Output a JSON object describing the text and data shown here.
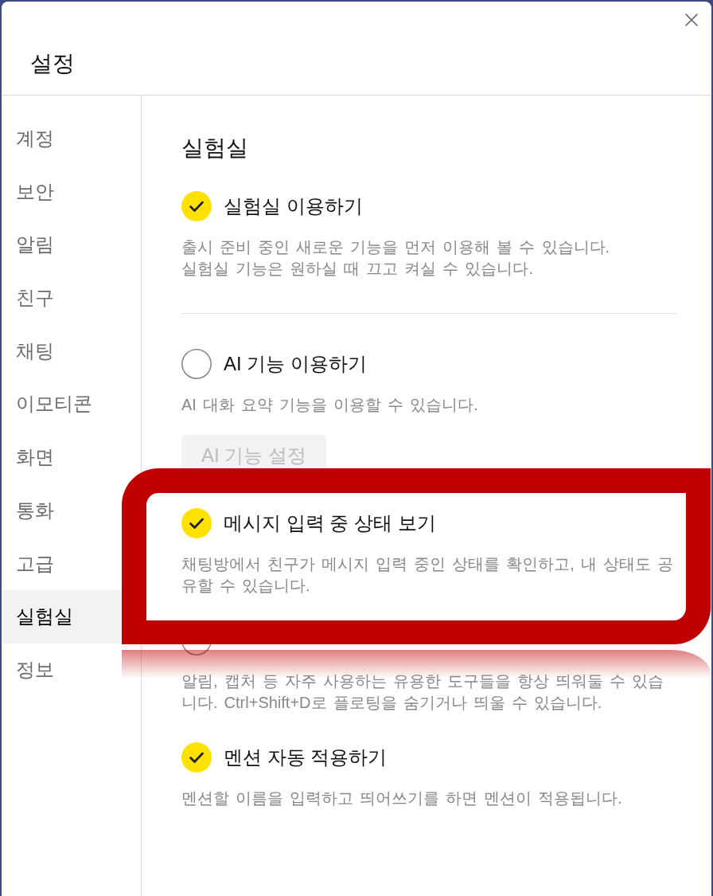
{
  "window": {
    "title": "설정"
  },
  "sidebar": {
    "items": [
      {
        "label": "계정",
        "selected": false
      },
      {
        "label": "보안",
        "selected": false
      },
      {
        "label": "알림",
        "selected": false
      },
      {
        "label": "친구",
        "selected": false
      },
      {
        "label": "채팅",
        "selected": false
      },
      {
        "label": "이모티콘",
        "selected": false
      },
      {
        "label": "화면",
        "selected": false
      },
      {
        "label": "통화",
        "selected": false
      },
      {
        "label": "고급",
        "selected": false
      },
      {
        "label": "실험실",
        "selected": true
      },
      {
        "label": "정보",
        "selected": false
      }
    ]
  },
  "section": {
    "heading": "실험실",
    "master": {
      "title": "실험실 이용하기",
      "checked": true,
      "description": "출시 준비 중인 새로운 기능을 먼저 이용해 볼 수 있습니다.\n실험실 기능은 원하실 때 끄고 켜실 수 있습니다."
    },
    "features": [
      {
        "title": "AI 기능 이용하기",
        "checked": false,
        "highlighted": false,
        "description": "AI 대화 요약 기능을 이용할 수 있습니다.",
        "button": {
          "label": "AI 기능 설정",
          "disabled": true
        }
      },
      {
        "title": "메시지 입력 중 상태 보기",
        "checked": true,
        "highlighted": true,
        "description": "채팅방에서 친구가 메시지 입력 중인 상태를 확인하고, 내 상태도 공유할 수 있습니다."
      },
      {
        "checked": false,
        "highlighted": false,
        "description": "알림, 캡처 등 자주 사용하는 유용한 도구들을 항상 띄워둘 수 있습니다. Ctrl+Shift+D로 플로팅을 숨기거나 띄울 수 있습니다."
      },
      {
        "title": "멘션 자동 적용하기",
        "checked": true,
        "highlighted": false,
        "description": "멘션할 이름을 입력하고 띄어쓰기를 하면 멘션이 적용됩니다."
      }
    ]
  }
}
